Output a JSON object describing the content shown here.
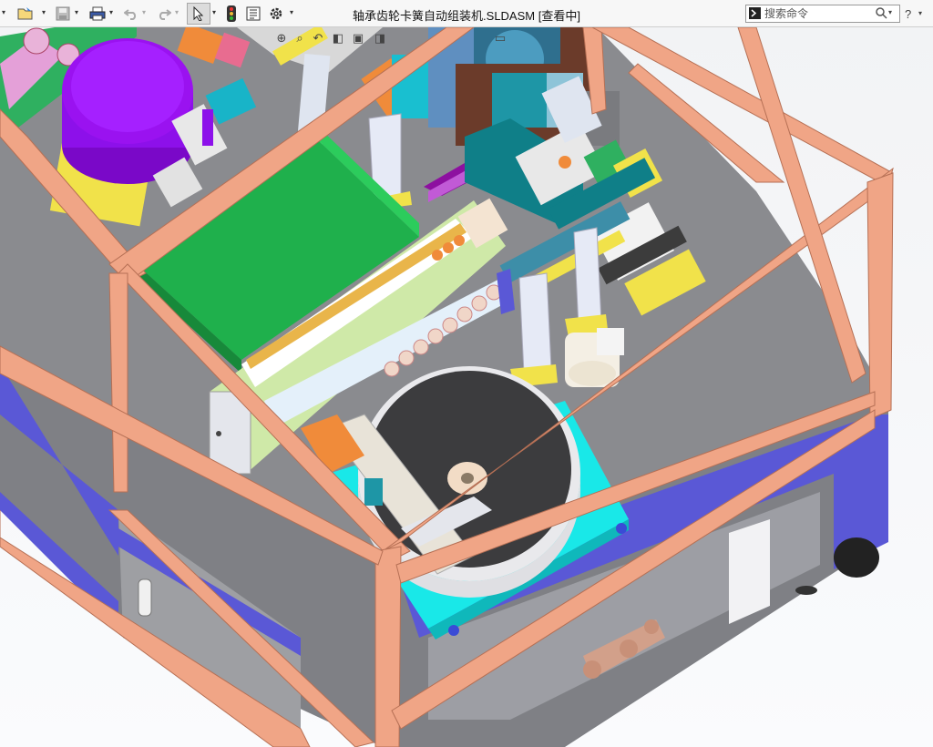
{
  "window": {
    "title": "轴承齿轮卡簧自动组装机.SLDASM [查看中]"
  },
  "toolbar": {
    "search_placeholder": "搜索命令"
  },
  "colors": {
    "floor": "#8a8b8f",
    "frame_orange": "#f0a586",
    "base_blue": "#5a58d6",
    "green_plate": "#1fb04c",
    "purple_bowl": "#9a12f0",
    "cyan_plate": "#19e8e8",
    "lime_track": "#cfe9a8",
    "yellow_bracket": "#f1e24a"
  },
  "icons": [
    "new-icon",
    "open-icon",
    "save-icon",
    "print-icon",
    "undo-icon",
    "redo-icon",
    "select-icon",
    "traffic-light-icon",
    "file-properties-icon",
    "options-icon",
    "search-commands-icon",
    "search-icon"
  ]
}
